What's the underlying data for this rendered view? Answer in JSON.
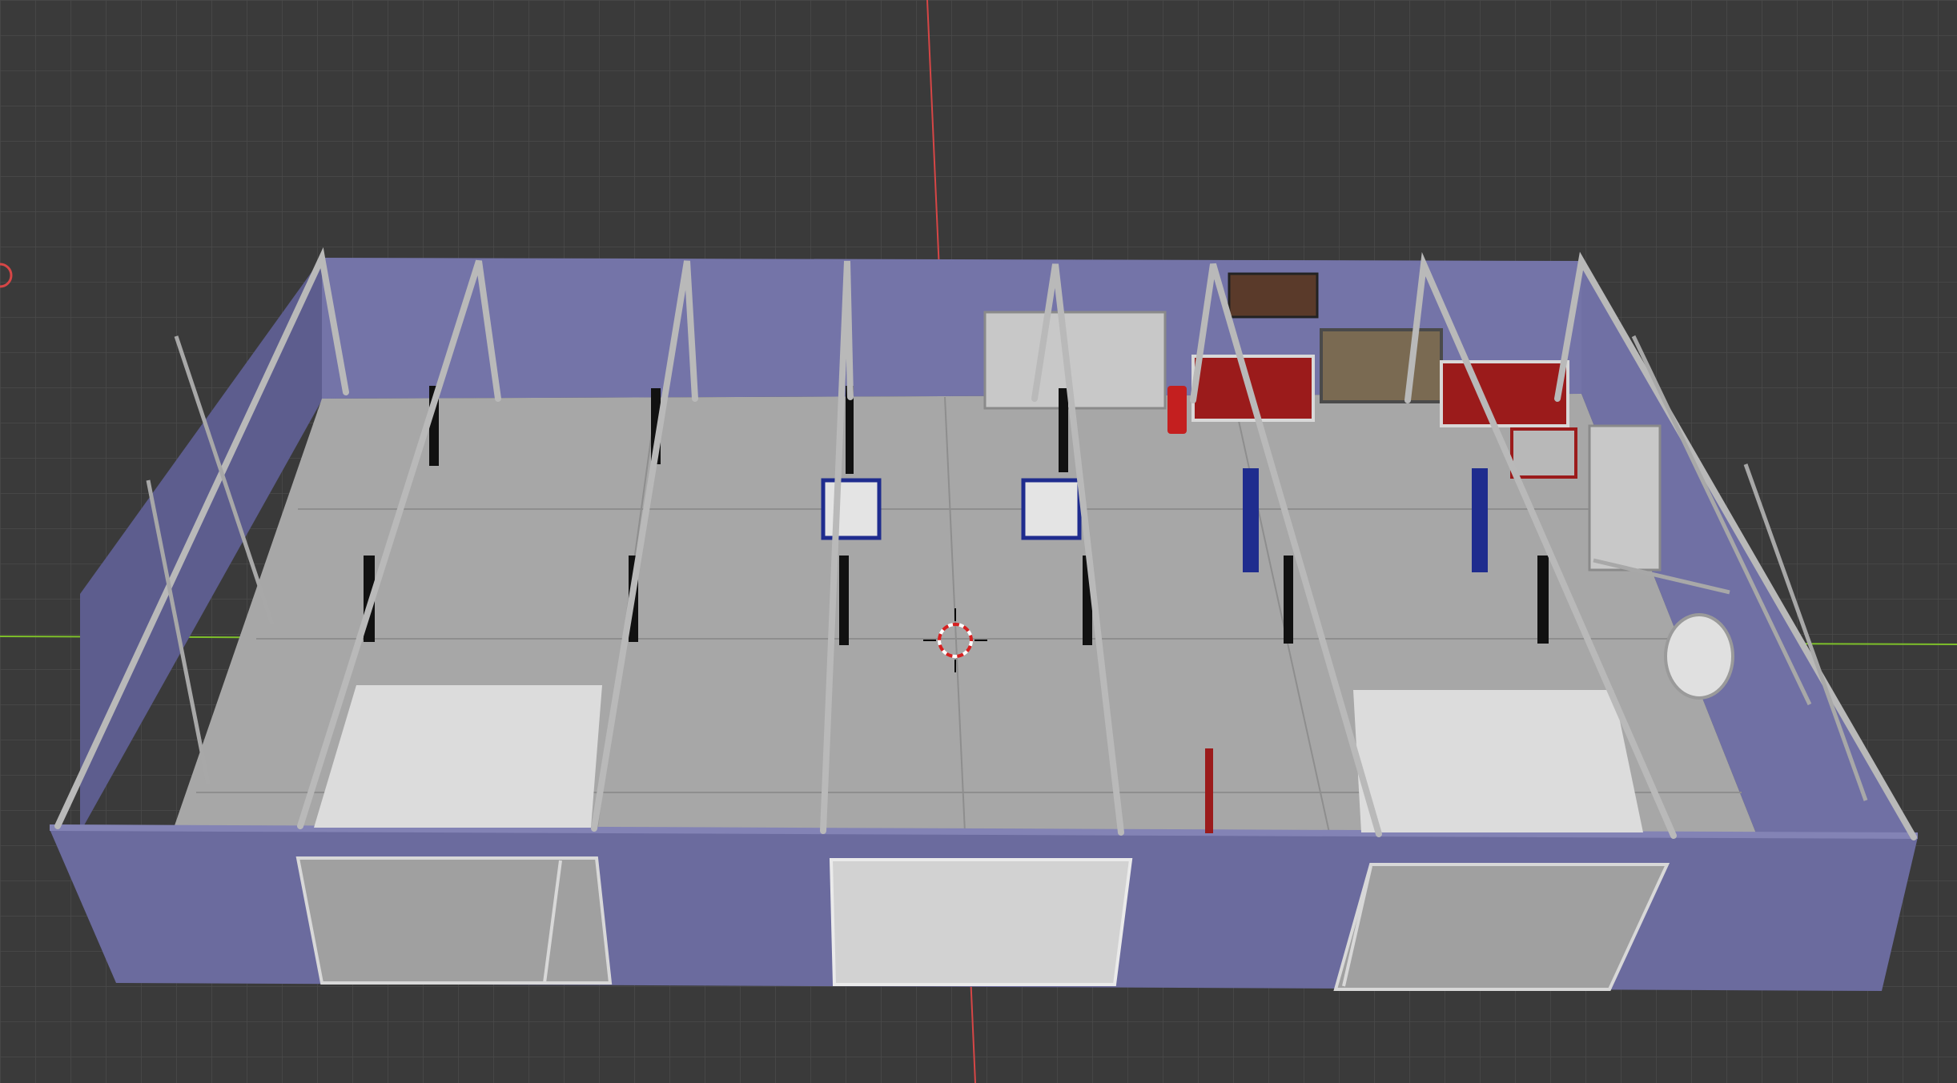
{
  "viewport": {
    "grid_color": "#4a4a4a",
    "background_color": "#3a3a3a",
    "x_axis_color": "#7dbf2a",
    "y_axis_color": "#d64646"
  },
  "scene": {
    "wall_color": "#6b6b9e",
    "wall_top_color": "#7474a8",
    "floor_color": "#a7a7a7",
    "floor_seam_color": "#8e8e8e",
    "truss_color": "#b9b9b9",
    "door_color": "#dcdcdc",
    "lift_accent_color": "#1f2c8e",
    "cabinet_accent_color": "#9b1b1b",
    "fuel_can_color": "#c41f1f"
  },
  "cursor": {
    "icon": "3d-cursor-icon"
  }
}
